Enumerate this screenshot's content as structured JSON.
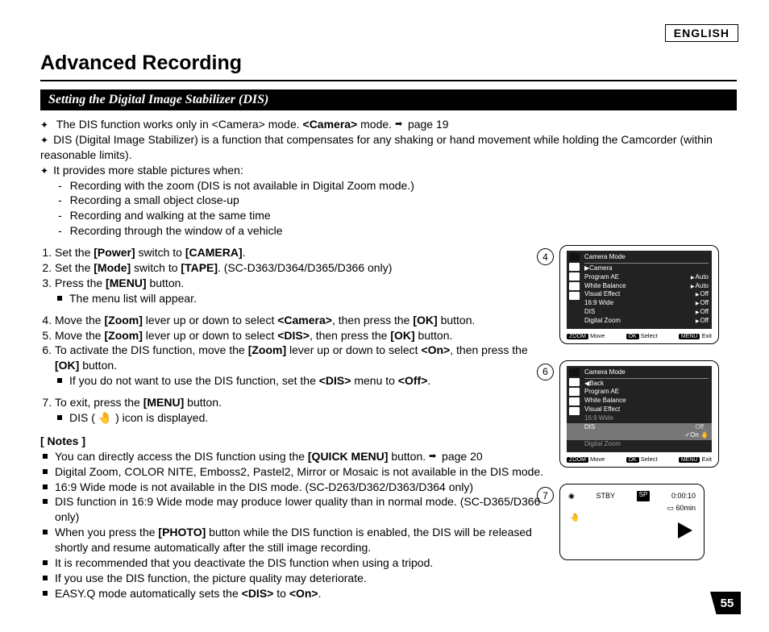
{
  "lang": "ENGLISH",
  "title": "Advanced Recording",
  "subhead": "Setting the Digital Image Stabilizer (DIS)",
  "intro": [
    {
      "type": "cross",
      "text": "The DIS function works only in <Camera> mode. ",
      "arrow": true,
      "tail": "page 19"
    },
    {
      "type": "cross",
      "text": "DIS (Digital Image Stabilizer) is a function that compensates for any shaking or hand movement while holding the Camcorder (within reasonable limits)."
    },
    {
      "type": "cross",
      "text": "It provides more stable pictures when:"
    },
    {
      "type": "dash",
      "text": "Recording with the zoom (DIS is not available in Digital Zoom mode.)"
    },
    {
      "type": "dash",
      "text": "Recording a small object close-up"
    },
    {
      "type": "dash",
      "text": "Recording and walking at the same time"
    },
    {
      "type": "dash",
      "text": "Recording through the window of a vehicle"
    }
  ],
  "steps": [
    "Set the [Power] switch to [CAMERA].",
    "Set the [Mode] switch to [TAPE]. (SC-D363/D364/D365/D366 only)",
    "Press the [MENU] button.",
    "Move the [Zoom] lever up or down to select <Camera>, then press the [OK] button.",
    "Move the [Zoom] lever up or down to select <DIS>, then press the [OK] button.",
    "To activate the DIS function, move the [Zoom] lever up or down to select <On>, then press the [OK] button.",
    "To exit, press the [MENU] button."
  ],
  "step_sub": {
    "2": "The menu list will appear.",
    "5": "If you do not want to use the DIS function, set the <DIS> menu to <Off>.",
    "6": "DIS ( 🤚 ) icon is displayed."
  },
  "notes_head": "[ Notes ]",
  "notes": [
    {
      "text": "You can directly access the DIS function using the [QUICK MENU] button. ",
      "arrow": true,
      "tail": "page 20"
    },
    {
      "text": "Digital Zoom, COLOR NITE, Emboss2, Pastel2, Mirror or Mosaic is not available in the DIS mode."
    },
    {
      "text": "16:9 Wide mode is not available in the DIS mode. (SC-D263/D362/D363/D364 only)"
    },
    {
      "text": "DIS function in 16:9 Wide mode may produce lower quality than in normal mode. (SC-D365/D366 only)"
    },
    {
      "text": "When you press the [PHOTO] button while the DIS function is enabled, the DIS will be released shortly and resume automatically after the still image recording."
    },
    {
      "text": "It is recommended that you deactivate the DIS function when using a tripod."
    },
    {
      "text": "If you use the DIS function, the picture quality may deteriorate."
    },
    {
      "text": "EASY.Q mode automatically sets the <DIS> to <On>."
    }
  ],
  "menu4": {
    "title": "Camera Mode",
    "selected": "▶Camera",
    "rows": [
      {
        "label": "Program AE",
        "val": "Auto"
      },
      {
        "label": "White Balance",
        "val": "Auto"
      },
      {
        "label": "Visual Effect",
        "val": "Off"
      },
      {
        "label": "16:9 Wide",
        "val": "Off"
      },
      {
        "label": "DIS",
        "val": "Off"
      },
      {
        "label": "Digital Zoom",
        "val": "Off"
      }
    ]
  },
  "menu6": {
    "title": "Camera Mode",
    "back": "◀Back",
    "rows": [
      {
        "label": "Program AE"
      },
      {
        "label": "White Balance"
      },
      {
        "label": "Visual Effect"
      },
      {
        "label": "16:9 Wide",
        "grey": true
      },
      {
        "label": "DIS",
        "highlight": true,
        "opts": [
          "Off",
          "✓On"
        ]
      },
      {
        "label": "Digital Zoom",
        "grey": true
      }
    ]
  },
  "footer": {
    "zoom": "ZOOM",
    "move": "Move",
    "ok": "OK",
    "select": "Select",
    "menu": "MENU",
    "exit": "Exit"
  },
  "status": {
    "stby": "STBY",
    "sp": "SP",
    "time": "0:00:10",
    "remain": "60min"
  },
  "step_markers": {
    "a": "4",
    "b": "6",
    "c": "7"
  },
  "page_num": "55"
}
